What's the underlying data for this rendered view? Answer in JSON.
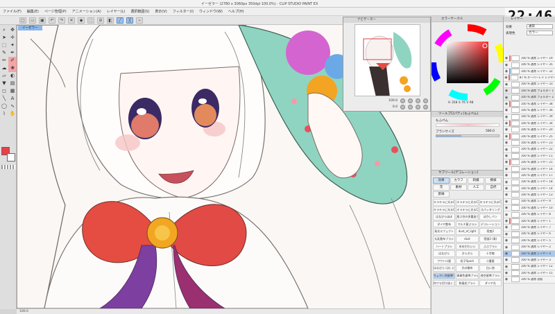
{
  "window": {
    "title": "イーゼラー (2780 x 3060px 350dpi 100.0%) - CLIP STUDIO PAINT EX"
  },
  "clock": "22:46",
  "menu": [
    "ファイル(F)",
    "編集(E)",
    "ページ管理(P)",
    "アニメーション(A)",
    "レイヤー(L)",
    "選択範囲(S)",
    "表示(V)",
    "フィルター(I)",
    "ウィンドウ(W)",
    "ヘルプ(H)"
  ],
  "canvas": {
    "tab": "イーゼラー",
    "status": "100.0"
  },
  "navigator": {
    "title": "ナビゲーター",
    "zoom": "100.0",
    "rotation": "0.0"
  },
  "color_panel": {
    "title": "カラーサークル",
    "readout": "H 358  S 76  V 98"
  },
  "tool_property": {
    "title": "ツールプロパティ[もふぺん]",
    "tool_name": "もふぺん",
    "size_label": "ブラシサイズ",
    "size_value": "580.0"
  },
  "sub_tool": {
    "title": "サブツール[デコレーション]",
    "categories": [
      "効果",
      "カラフ",
      "刺繍",
      "模様",
      "花",
      "素材",
      "人工",
      "自然",
      "罫線"
    ],
    "brushes": [
      "キラキラに光るCOB",
      "キラキラに光るCO B",
      "キラキラに光るCOB1",
      "キラキラに光るCOB2",
      "キラキラに光るCOB3",
      "スパッタリング",
      "はなびらほぼ",
      "星ぶ空の多重塗りカ",
      "ぼかしペン",
      "ダイヤ散布",
      "マルチ星ぶラシ",
      "デコレーション",
      "発光エフェクト",
      "dust_ef_light",
      "密度2",
      "丸乳散布ブラシ",
      "dust",
      "密度2 (青)",
      "ハートブラシ",
      "ゆめかわいい",
      "ぶぶブラシ",
      "はなびら",
      "きらきら",
      "十字線",
      "フワトロ星",
      "粒子Spark",
      "二重星",
      "はなびら (点) ぶ の",
      "光の散布",
      "白い泡",
      "ちょかい泡星降ブラシ",
      "青春色星降ブラシ",
      "夜空星降ブラシ",
      "何でも切り抜くブラシ",
      "和風花ブラシ",
      "ダイヤ光"
    ]
  },
  "layer_panel": {
    "title": "レイヤー",
    "blend_label": "効果",
    "blend_value": "通常",
    "opacity_label": "表現色",
    "opacity_value": "カラー",
    "layers": [
      "100 % 通常 レイヤー 19",
      "100 % 通常 レイヤー 35",
      "100 % 通常 レイヤー 32",
      "87 % オーバーレイ レイヤー 14",
      "100 % 通常 レイヤー 33",
      "100 % 通常 フォルダー 1",
      "100 % 通常 フォルダー 2",
      "100 % 通常 レイヤー 38",
      "100 % 通常 レイヤー 36",
      "100 % 通常 レイヤー 39",
      "100 % 通常 レイヤー 34",
      "100 % 通常 レイヤー 20",
      "100 % 通常 レイヤー 25",
      "100 % 通常 レイヤー 23",
      "100 % 通常 レイヤー 22",
      "100 % 通常 レイヤー 11",
      "100 % 通常 レイヤー 21",
      "100 % 通常 レイヤー 16",
      "100 % 通常 レイヤー 17",
      "100 % 通常 レイヤー 18",
      "100 % 通常 レイヤー 14",
      "100 % 通常 レイヤー 13",
      "100 % 通常 レイヤー 9",
      "100 % 通常 レイヤー 10",
      "100 % 通常 レイヤー 8",
      "100 % 通常 レイヤー 1",
      "100 % 通常 レイヤー 7",
      "100 % 通常 レイヤー 6",
      "100 % 通常 レイヤー 5",
      "100 % 通常 レイヤー 2",
      "100 % 通常 レイヤー 4",
      "100 % 通常 レイヤー 3",
      "100 % 通常 レイヤー 12",
      "100 % 通常 レイヤー 15",
      "100 % 通常 用紙"
    ]
  },
  "colors": {
    "accent": "#8cb7e8",
    "main_color": "#e8404a",
    "selected_layer": "#a9c8ee"
  }
}
